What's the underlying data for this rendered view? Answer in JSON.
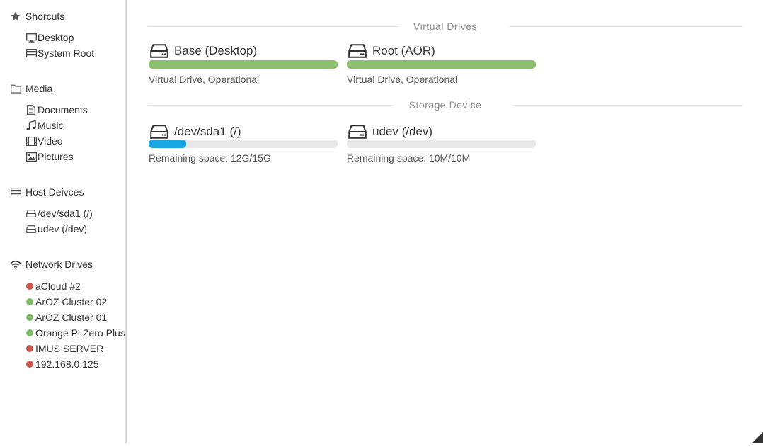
{
  "sidebar": {
    "shortcuts": {
      "label": "Shorcuts",
      "icon": "star-icon",
      "items": [
        {
          "label": "Desktop",
          "icon": "monitor-icon"
        },
        {
          "label": "System Root",
          "icon": "server-icon"
        }
      ]
    },
    "media": {
      "label": "Media",
      "icon": "folder-icon",
      "items": [
        {
          "label": "Documents",
          "icon": "document-icon"
        },
        {
          "label": "Music",
          "icon": "music-icon"
        },
        {
          "label": "Video",
          "icon": "film-icon"
        },
        {
          "label": "Pictures",
          "icon": "image-icon"
        }
      ]
    },
    "host_devices": {
      "label": "Host Deivces",
      "icon": "server-icon",
      "items": [
        {
          "label": "/dev/sda1 (/)",
          "icon": "hdd-icon"
        },
        {
          "label": "udev (/dev)",
          "icon": "hdd-icon"
        }
      ]
    },
    "network_drives": {
      "label": "Network Drives",
      "icon": "wifi-icon",
      "items": [
        {
          "label": "aCloud #2",
          "status": "offline"
        },
        {
          "label": "ArOZ Cluster 02",
          "status": "online"
        },
        {
          "label": "ArOZ Cluster 01",
          "status": "online"
        },
        {
          "label": "Orange Pi Zero Plus",
          "status": "online"
        },
        {
          "label": "IMUS SERVER",
          "status": "offline"
        },
        {
          "label": "192.168.0.125",
          "status": "offline"
        }
      ]
    }
  },
  "main": {
    "virtual_drives": {
      "heading": "Virtual Drives",
      "drives": [
        {
          "name": "Base (Desktop)",
          "subtitle": "Virtual Drive, Operational",
          "fill": 1.0,
          "color": "#8cbf6e"
        },
        {
          "name": "Root (AOR)",
          "subtitle": "Virtual Drive, Operational",
          "fill": 1.0,
          "color": "#8cbf6e"
        }
      ]
    },
    "storage_devices": {
      "heading": "Storage Device",
      "devices": [
        {
          "name": "/dev/sda1 (/)",
          "subtitle": "Remaining space: 12G/15G",
          "fill": 0.2,
          "color": "#1ba6e6"
        },
        {
          "name": "udev (/dev)",
          "subtitle": "Remaining space: 10M/10M",
          "fill": 0.0,
          "color": "#1ba6e6"
        }
      ]
    }
  },
  "colors": {
    "online": "#80b96a",
    "offline": "#c9574e",
    "divider": "#e6e6e6",
    "sidebar_border": "#dadada"
  }
}
